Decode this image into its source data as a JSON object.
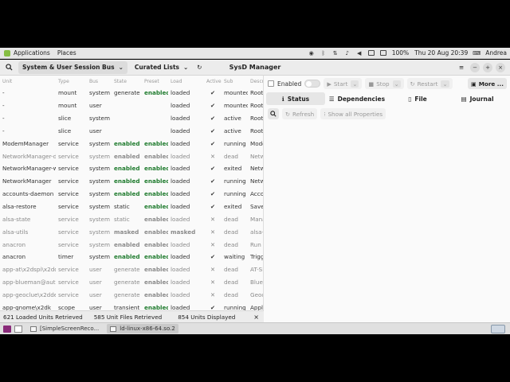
{
  "system_panel": {
    "menu": [
      "Applications",
      "Places"
    ],
    "tray": {
      "battery": "100%",
      "datetime": "Thu 20 Aug  20:39",
      "user": "Andrea"
    }
  },
  "app": {
    "title": "SysD Manager",
    "bus_selector": "System & User Session Bus",
    "list_selector": "Curated Lists",
    "columns": [
      "Unit",
      "Type",
      "Bus",
      "State",
      "Preset",
      "Load",
      "Active",
      "Sub",
      "Description"
    ],
    "units": [
      {
        "unit": "-",
        "type": "mount",
        "bus": "system",
        "state": "generate",
        "preset": "enabled",
        "load": "loaded",
        "active": "✔",
        "sub": "mounted",
        "desc": "Root",
        "inactive": false
      },
      {
        "unit": "-",
        "type": "mount",
        "bus": "user",
        "state": "",
        "preset": "",
        "load": "loaded",
        "active": "✔",
        "sub": "mounted",
        "desc": "Root",
        "inactive": false
      },
      {
        "unit": "-",
        "type": "slice",
        "bus": "system",
        "state": "",
        "preset": "",
        "load": "loaded",
        "active": "✔",
        "sub": "active",
        "desc": "Root",
        "inactive": false
      },
      {
        "unit": "-",
        "type": "slice",
        "bus": "user",
        "state": "",
        "preset": "",
        "load": "loaded",
        "active": "✔",
        "sub": "active",
        "desc": "Root",
        "inactive": false
      },
      {
        "unit": "ModemManager",
        "type": "service",
        "bus": "system",
        "state": "enabled",
        "preset": "enabled",
        "load": "loaded",
        "active": "✔",
        "sub": "running",
        "desc": "Mode",
        "inactive": false
      },
      {
        "unit": "NetworkManager-dispatcher",
        "type": "service",
        "bus": "system",
        "state": "enabled",
        "preset": "enabled",
        "load": "loaded",
        "active": "✕",
        "sub": "dead",
        "desc": "Netw",
        "inactive": true
      },
      {
        "unit": "NetworkManager-wait-online",
        "type": "service",
        "bus": "system",
        "state": "enabled",
        "preset": "enabled",
        "load": "loaded",
        "active": "✔",
        "sub": "exited",
        "desc": "Netw",
        "inactive": false
      },
      {
        "unit": "NetworkManager",
        "type": "service",
        "bus": "system",
        "state": "enabled",
        "preset": "enabled",
        "load": "loaded",
        "active": "✔",
        "sub": "running",
        "desc": "Netw",
        "inactive": false
      },
      {
        "unit": "accounts-daemon",
        "type": "service",
        "bus": "system",
        "state": "enabled",
        "preset": "enabled",
        "load": "loaded",
        "active": "✔",
        "sub": "running",
        "desc": "Acco",
        "inactive": false
      },
      {
        "unit": "alsa-restore",
        "type": "service",
        "bus": "system",
        "state": "static",
        "preset": "enabled",
        "load": "loaded",
        "active": "✔",
        "sub": "exited",
        "desc": "Save/",
        "inactive": false
      },
      {
        "unit": "alsa-state",
        "type": "service",
        "bus": "system",
        "state": "static",
        "preset": "enabled",
        "load": "loaded",
        "active": "✕",
        "sub": "dead",
        "desc": "Mana",
        "inactive": true
      },
      {
        "unit": "alsa-utils",
        "type": "service",
        "bus": "system",
        "state": "masked",
        "preset": "enabled",
        "load": "masked",
        "active": "✕",
        "sub": "dead",
        "desc": "alsa-u",
        "inactive": true
      },
      {
        "unit": "anacron",
        "type": "service",
        "bus": "system",
        "state": "enabled",
        "preset": "enabled",
        "load": "loaded",
        "active": "✕",
        "sub": "dead",
        "desc": "Run a",
        "inactive": true
      },
      {
        "unit": "anacron",
        "type": "timer",
        "bus": "system",
        "state": "enabled",
        "preset": "enabled",
        "load": "loaded",
        "active": "✔",
        "sub": "waiting",
        "desc": "Trigg",
        "inactive": false
      },
      {
        "unit": "app-at\\x2dspi\\x2dd",
        "type": "service",
        "bus": "user",
        "state": "generate",
        "preset": "enabled",
        "load": "loaded",
        "active": "✕",
        "sub": "dead",
        "desc": "AT-SP",
        "inactive": true
      },
      {
        "unit": "app-blueman@auto",
        "type": "service",
        "bus": "user",
        "state": "generate",
        "preset": "enabled",
        "load": "loaded",
        "active": "✕",
        "sub": "dead",
        "desc": "Bluem",
        "inactive": true
      },
      {
        "unit": "app-geoclue\\x2dde",
        "type": "service",
        "bus": "user",
        "state": "generate",
        "preset": "enabled",
        "load": "loaded",
        "active": "✕",
        "sub": "dead",
        "desc": "Geoc",
        "inactive": true
      },
      {
        "unit": "app-gnome\\x2dk",
        "type": "scope",
        "bus": "user",
        "state": "transient",
        "preset": "enabled",
        "load": "loaded",
        "active": "✔",
        "sub": "running",
        "desc": "Appli",
        "inactive": false
      }
    ],
    "footer": {
      "loaded": "621 Loaded Units Retrieved",
      "files": "585 Unit Files Retrieved",
      "displayed": "854 Units Displayed"
    },
    "detail": {
      "enabled_label": "Enabled",
      "start_label": "Start",
      "stop_label": "Stop",
      "restart_label": "Restart",
      "more_label": "More ...",
      "tabs": [
        "Status",
        "Dependencies",
        "File",
        "Journal"
      ],
      "refresh_label": "Refresh",
      "show_all_label": "Show all Properties"
    }
  },
  "taskbar": {
    "tasks": [
      "[SimpleScreenReco...",
      "ld-linux-x86-64.so.2"
    ]
  }
}
